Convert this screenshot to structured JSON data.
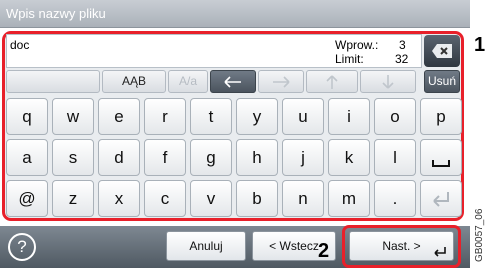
{
  "window": {
    "title": "Wpis nazwy pliku"
  },
  "input": {
    "value": "doc"
  },
  "counters": {
    "entry_label": "Wprow.:",
    "entry_value": "3",
    "limit_label": "Limit:",
    "limit_value": "32"
  },
  "controls": {
    "case_left": "",
    "case_toggle": "AĄB",
    "alpha_toggle": "A/a",
    "delete_label": "Usuń"
  },
  "keyboard": {
    "row1": [
      "q",
      "w",
      "e",
      "r",
      "t",
      "y",
      "u",
      "i",
      "o",
      "p"
    ],
    "row2": [
      "a",
      "s",
      "d",
      "f",
      "g",
      "h",
      "j",
      "k",
      "l"
    ],
    "row3": [
      "@",
      "z",
      "x",
      "c",
      "v",
      "b",
      "n",
      "m",
      "."
    ]
  },
  "footer": {
    "help_glyph": "?",
    "cancel_label": "Anuluj",
    "back_label": "< Wstecz",
    "next_label": "Nast. >"
  },
  "callouts": {
    "one": "1",
    "two": "2"
  },
  "image_code": "GB0057_06"
}
